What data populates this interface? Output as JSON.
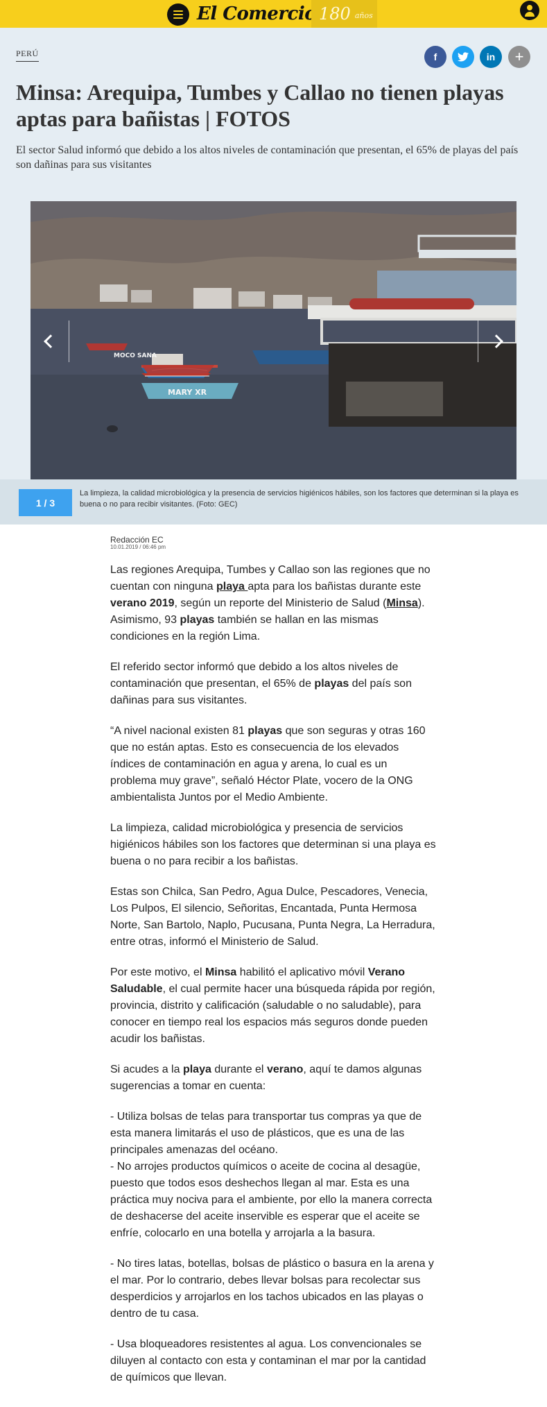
{
  "header": {
    "logo": "El Comercio",
    "anniversary_number": "180",
    "anniversary_word": "años",
    "brand_color": "#f7cf1c",
    "menu_icon": "hamburger-menu-icon",
    "user_icon": "user-icon"
  },
  "section": "PERÚ",
  "share": {
    "facebook": "f",
    "twitter": "t",
    "linkedin": "in",
    "more": "+"
  },
  "headline": "Minsa: Arequipa, Tumbes y Callao no tienen playas aptas para bañistas | FOTOS",
  "subheadline": "El sector Salud informó que debido a los altos niveles de contaminación que presentan, el 65% de playas del país son dañinas para sus visitantes",
  "gallery": {
    "counter": "1 / 3",
    "caption": "La limpieza, la calidad microbiológica y la presencia de servicios higiénicos hábiles, son los factores que determinan si la playa es buena o no para recibir visitantes. (Foto: GEC)",
    "boat_labels": [
      "MARY XR",
      "MOCO SANA"
    ],
    "counter_color": "#3ea2ef"
  },
  "article": {
    "author": "Redacción EC",
    "date": "10.01.2019 / 06:46 pm",
    "p1": {
      "t1": "Las regiones Arequipa, Tumbes y Callao son las regiones que no cuentan con ninguna ",
      "link1": "playa ",
      "t2": "apta para los bañistas durante este ",
      "b1": "verano 2019",
      "t3": ", según un reporte del Ministerio de Salud (",
      "link2": "Minsa",
      "t4": "). Asimismo, 93 ",
      "b2": "playas",
      "t5": " también se hallan en las mismas condiciones en la región Lima."
    },
    "p2": {
      "t1": "El referido sector informó que debido a los altos niveles de contaminación que presentan, el 65% de ",
      "b1": "playas",
      "t2": " del país son dañinas para sus visitantes."
    },
    "p3": {
      "t1": "“A nivel nacional existen 81 ",
      "b1": "playas",
      "t2": " que son seguras y otras 160 que no están aptas. Esto es consecuencia de los elevados índices de contaminación en agua y arena, lo cual es un problema muy grave”, señaló Héctor Plate, vocero de la ONG ambientalista Juntos por el Medio Ambiente."
    },
    "p4": "La limpieza, calidad microbiológica y presencia de servicios higiénicos hábiles son los factores que determinan si una playa es buena o no para recibir a los bañistas.",
    "p5": "Estas son Chilca, San Pedro, Agua Dulce, Pescadores, Venecia, Los Pulpos, El silencio, Señoritas, Encantada, Punta Hermosa Norte, San Bartolo, Naplo, Pucusana, Punta Negra, La Herradura, entre otras, informó el Ministerio de Salud.",
    "p6": {
      "t1": "Por este motivo, el ",
      "b1": "Minsa",
      "t2": " habilitó el aplicativo móvil ",
      "b2": "Verano Saludable",
      "t3": ", el cual permite hacer una búsqueda rápida por región, provincia, distrito y calificación (saludable o no saludable), para conocer en tiempo real los espacios más seguros donde pueden acudir los bañistas."
    },
    "p7": {
      "t1": "Si acudes a la ",
      "b1": "playa",
      "t2": " durante el ",
      "b2": "verano",
      "t3": ", aquí te damos algunas sugerencias a tomar en cuenta:"
    },
    "tip1": "- Utiliza bolsas de telas para transportar tus compras ya que de esta manera limitarás el uso de plásticos, que es una de las principales amenazas del océano.",
    "tip2": "- No arrojes productos químicos o aceite de cocina al desagüe, puesto que todos esos deshechos llegan al mar. Esta es una práctica muy nociva para el ambiente, por ello la manera correcta de deshacerse del aceite inservible es esperar que el aceite se enfríe, colocarlo en una botella y arrojarla a la basura.",
    "tip3": "- No tires latas, botellas, bolsas de plástico o basura en la arena y el mar. Por lo contrario, debes llevar bolsas para recolectar sus desperdicios y arrojarlos en los tachos ubicados en las playas o dentro de tu casa.",
    "tip4": "- Usa bloqueadores resistentes al agua. Los convencionales se diluyen al contacto con esta y contaminan el mar por la cantidad de químicos que llevan."
  }
}
